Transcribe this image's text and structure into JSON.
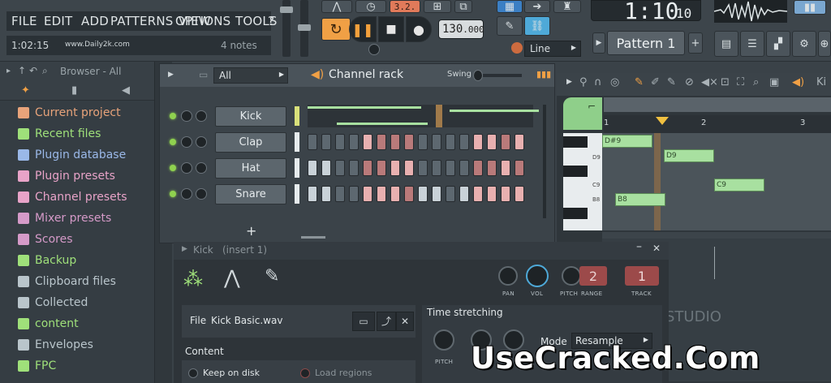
{
  "menu": {
    "items": [
      "FILE",
      "EDIT",
      "ADD",
      "PATTERNS",
      "VIEW",
      "OPTIONS",
      "TOOLS",
      "?"
    ]
  },
  "hint": {
    "time": "1:02:15",
    "site": "www.Daily2k.com",
    "notes": "4 notes"
  },
  "transport": {
    "tempo_main": "130",
    "tempo_decimal": ".000",
    "song_time_main": "1:10",
    "song_time_sub": "10",
    "pattern": "Pattern 1",
    "snap": "Line",
    "mode_display": "3.2."
  },
  "browser": {
    "title": "Browser - All",
    "items": [
      {
        "label": "Current project",
        "color": "#e8a37a"
      },
      {
        "label": "Recent files",
        "color": "#9fe07a"
      },
      {
        "label": "Plugin database",
        "color": "#9ab8e8"
      },
      {
        "label": "Plugin presets",
        "color": "#e8a3c8"
      },
      {
        "label": "Channel presets",
        "color": "#e8a3c8"
      },
      {
        "label": "Mixer presets",
        "color": "#d59ac8"
      },
      {
        "label": "Scores",
        "color": "#d59ac8"
      },
      {
        "label": "Backup",
        "color": "#9fe07a"
      },
      {
        "label": "Clipboard files",
        "color": "#b9c5cb"
      },
      {
        "label": "Collected",
        "color": "#b9c5cb"
      },
      {
        "label": "content",
        "color": "#9fe07a"
      },
      {
        "label": "Envelopes",
        "color": "#b9c5cb"
      },
      {
        "label": "FPC",
        "color": "#9fe07a"
      }
    ]
  },
  "rack": {
    "filter": "All",
    "title": "Channel rack",
    "swing": "Swing",
    "add": "+",
    "channels": [
      {
        "name": "Kick",
        "steps": [
          1,
          0,
          0,
          0,
          0,
          0,
          0,
          0,
          0,
          0,
          0,
          0,
          0,
          0,
          0,
          0
        ]
      },
      {
        "name": "Clap",
        "steps": [
          0,
          0,
          0,
          0,
          1,
          0,
          0,
          0,
          0,
          0,
          0,
          0,
          1,
          1,
          0,
          1
        ]
      },
      {
        "name": "Hat",
        "steps": [
          1,
          1,
          0,
          0,
          0,
          0,
          1,
          1,
          0,
          0,
          0,
          0,
          0,
          0,
          1,
          0
        ]
      },
      {
        "name": "Snare",
        "steps": [
          1,
          1,
          0,
          0,
          1,
          1,
          1,
          0,
          1,
          1,
          0,
          1,
          1,
          1,
          1,
          1
        ]
      }
    ]
  },
  "piano": {
    "tab": "Ki",
    "bars": [
      "1",
      "2",
      "3"
    ],
    "keys": [
      "D9",
      "C9",
      "B8"
    ],
    "notes": [
      {
        "label": "D#9"
      },
      {
        "label": "D9"
      },
      {
        "label": "C9"
      },
      {
        "label": "B8"
      }
    ]
  },
  "settings": {
    "title": "Kick",
    "insert": "(insert 1)",
    "labels": {
      "pan": "PAN",
      "vol": "VOL",
      "pitch": "PITCH",
      "range": "RANGE",
      "track": "TRACK"
    },
    "range_value": "2",
    "track_value": "1",
    "file_label": "File",
    "file_name": "Kick Basic.wav",
    "content_label": "Content",
    "keep_on_disk": "Keep on disk",
    "load_regions": "Load regions",
    "time_stretching": "Time stretching",
    "pitch_label": "PITCH",
    "mode_label": "Mode",
    "mode_value": "Resample"
  },
  "watermark": "UseCracked.Com",
  "studio_text": "STUDIO"
}
